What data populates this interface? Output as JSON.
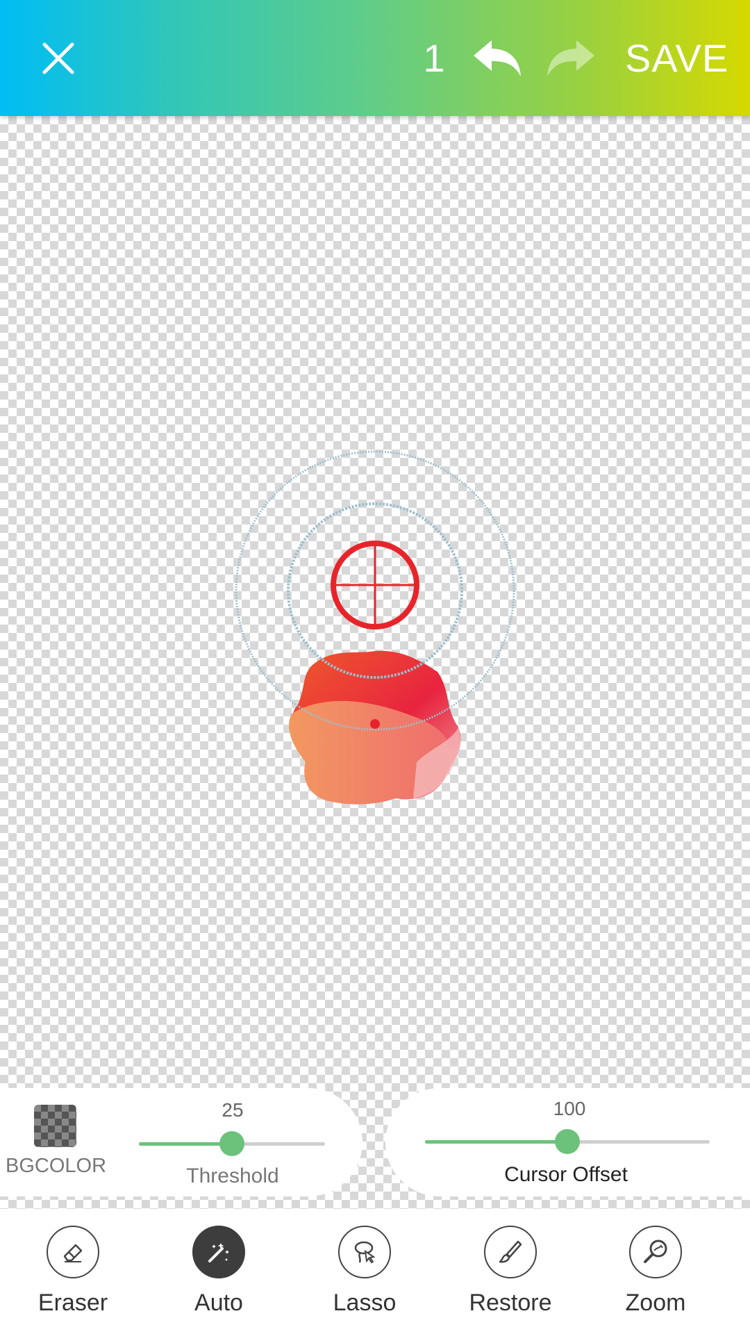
{
  "header": {
    "close_icon": "close-icon",
    "step_count": "1",
    "undo_icon": "undo-icon",
    "redo_icon": "redo-icon",
    "save_label": "SAVE"
  },
  "controls": {
    "bgcolor": {
      "label": "BGCOLOR",
      "icon": "checkerboard-swatch-icon"
    },
    "threshold": {
      "label": "Threshold",
      "value": "25",
      "min": 0,
      "max": 50
    },
    "cursor_offset": {
      "label": "Cursor Offset",
      "value": "100",
      "min": 0,
      "max": 200
    },
    "accent_color": "#6cc27a"
  },
  "tools": [
    {
      "label": "Eraser",
      "icon": "eraser-icon",
      "active": false
    },
    {
      "label": "Auto",
      "icon": "magic-wand-icon",
      "active": true
    },
    {
      "label": "Lasso",
      "icon": "lasso-icon",
      "active": false
    },
    {
      "label": "Restore",
      "icon": "brush-icon",
      "active": false
    },
    {
      "label": "Zoom",
      "icon": "zoom-icon",
      "active": false
    }
  ],
  "colors": {
    "header_gradient_start": "#00bdf5",
    "header_gradient_end": "#d6d900",
    "crosshair": "#e8242b"
  }
}
